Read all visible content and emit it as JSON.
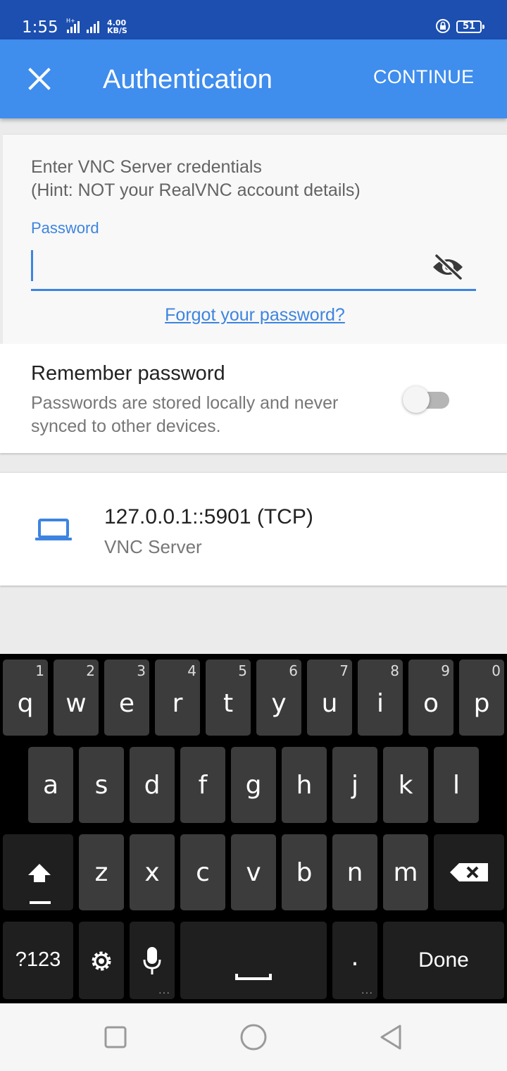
{
  "status_bar": {
    "time": "1:55",
    "network_type": "H+",
    "speed_value": "4.00",
    "speed_unit": "KB/S",
    "battery": "51"
  },
  "app_bar": {
    "title": "Authentication",
    "continue_label": "CONTINUE",
    "close_icon": "close-icon"
  },
  "credentials": {
    "instruction_line1": "Enter VNC Server credentials",
    "instruction_line2": "(Hint: NOT your RealVNC account details)",
    "password_label": "Password",
    "password_value": "",
    "visibility_icon": "eye-off-icon",
    "forgot_link": "Forgot your password?"
  },
  "remember": {
    "title": "Remember password",
    "description": "Passwords are stored locally and never synced to other devices.",
    "enabled": false
  },
  "server": {
    "address": "127.0.0.1::5901 (TCP)",
    "name": "VNC Server",
    "icon": "laptop-icon"
  },
  "keyboard": {
    "row1": [
      {
        "label": "q",
        "hint": "1"
      },
      {
        "label": "w",
        "hint": "2"
      },
      {
        "label": "e",
        "hint": "3"
      },
      {
        "label": "r",
        "hint": "4"
      },
      {
        "label": "t",
        "hint": "5"
      },
      {
        "label": "y",
        "hint": "6"
      },
      {
        "label": "u",
        "hint": "7"
      },
      {
        "label": "i",
        "hint": "8"
      },
      {
        "label": "o",
        "hint": "9"
      },
      {
        "label": "p",
        "hint": "0"
      }
    ],
    "row2": [
      "a",
      "s",
      "d",
      "f",
      "g",
      "h",
      "j",
      "k",
      "l"
    ],
    "row3": [
      "z",
      "x",
      "c",
      "v",
      "b",
      "n",
      "m"
    ],
    "symbols_label": "?123",
    "period_label": ".",
    "done_label": "Done"
  },
  "colors": {
    "status_bar": "#1c4fb0",
    "app_bar": "#3f8ded",
    "accent": "#3d84e0",
    "keyboard_bg": "#000000",
    "key_bg": "#3c3c3c"
  }
}
